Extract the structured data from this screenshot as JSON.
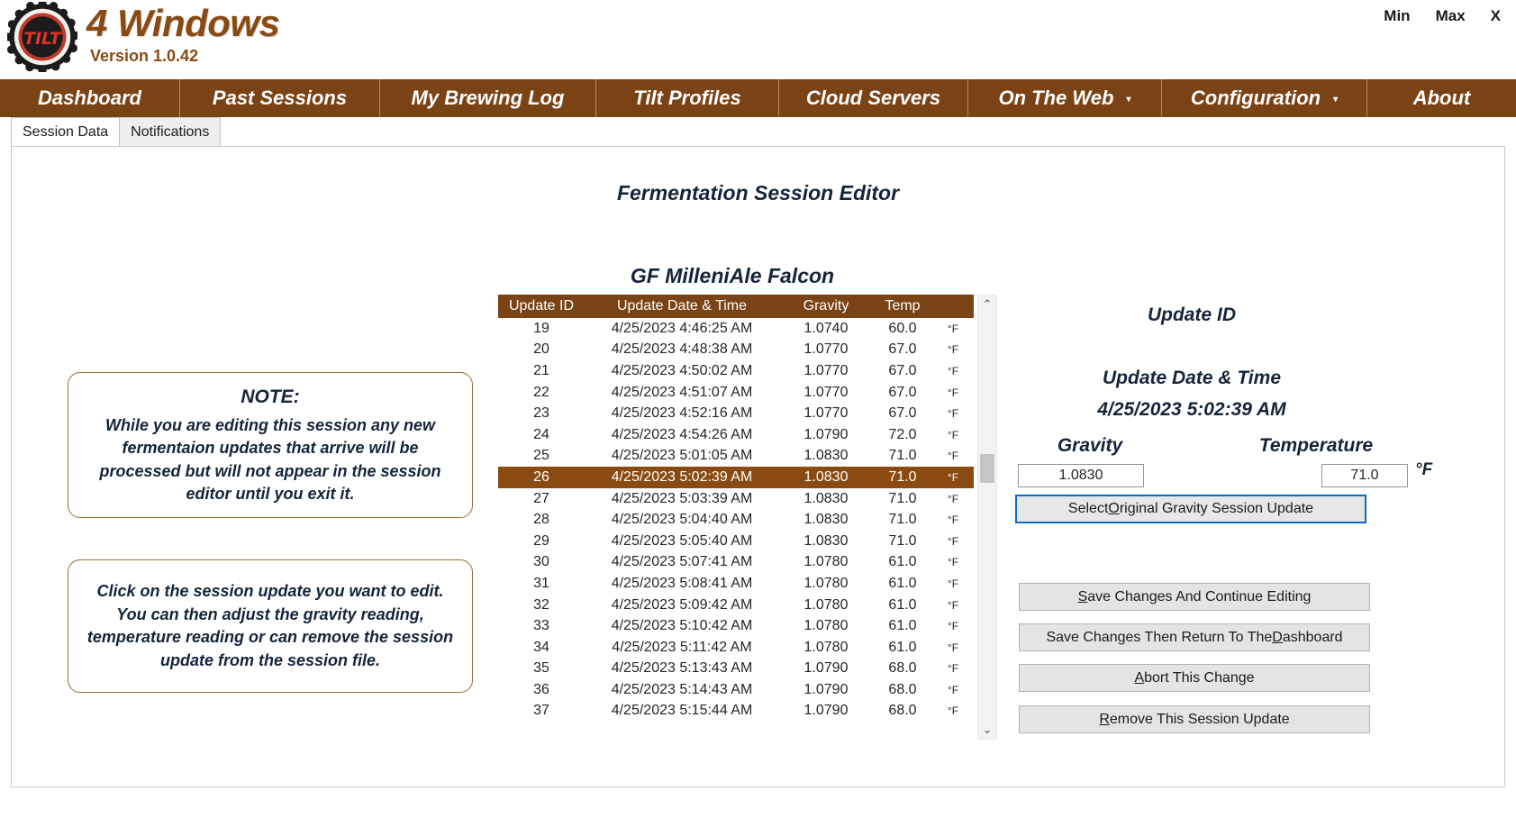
{
  "window": {
    "controls": [
      {
        "name": "minimize",
        "label": "Min"
      },
      {
        "name": "maximize",
        "label": "Max"
      },
      {
        "name": "close",
        "label": "X"
      }
    ]
  },
  "header": {
    "app_title": "4 Windows",
    "version": "Version 1.0.42",
    "logo_text": "TILT",
    "brand_color": "#8a4a12"
  },
  "menubar": {
    "accent_color": "#7a4316",
    "items": [
      {
        "label": "Dashboard",
        "has_caret": false
      },
      {
        "label": "Past Sessions",
        "has_caret": false
      },
      {
        "label": "My Brewing Log",
        "has_caret": false
      },
      {
        "label": "Tilt Profiles",
        "has_caret": false
      },
      {
        "label": "Cloud Servers",
        "has_caret": false
      },
      {
        "label": "On The Web",
        "has_caret": true,
        "caret": "▾"
      },
      {
        "label": "Configuration",
        "has_caret": true,
        "caret": "▾"
      },
      {
        "label": "About",
        "has_caret": false
      }
    ]
  },
  "tabs": [
    {
      "label": "Session Data",
      "active": true
    },
    {
      "label": "Notifications",
      "active": false
    }
  ],
  "main": {
    "editor_title": "Fermentation Session Editor",
    "session_name": "GF MilleniAle Falcon"
  },
  "notes": {
    "note1_head": "NOTE:",
    "note1_body": "While you are editing this session any new fermentaion updates that arrive will be processed but will not appear in the session editor until you exit it.",
    "note2_body": "Click on the session update you want to edit. You can then adjust the gravity reading, temperature reading or can remove the session update from the session file."
  },
  "table": {
    "columns": [
      "Update ID",
      "Update Date & Time",
      "Gravity",
      "Temp",
      ""
    ],
    "selected_id": 26,
    "rows": [
      {
        "id": "19",
        "datetime": "4/25/2023 4:46:25 AM",
        "gravity": "1.0740",
        "temp": "60.0",
        "unit": "°F"
      },
      {
        "id": "20",
        "datetime": "4/25/2023 4:48:38 AM",
        "gravity": "1.0770",
        "temp": "67.0",
        "unit": "°F"
      },
      {
        "id": "21",
        "datetime": "4/25/2023 4:50:02 AM",
        "gravity": "1.0770",
        "temp": "67.0",
        "unit": "°F"
      },
      {
        "id": "22",
        "datetime": "4/25/2023 4:51:07 AM",
        "gravity": "1.0770",
        "temp": "67.0",
        "unit": "°F"
      },
      {
        "id": "23",
        "datetime": "4/25/2023 4:52:16 AM",
        "gravity": "1.0770",
        "temp": "67.0",
        "unit": "°F"
      },
      {
        "id": "24",
        "datetime": "4/25/2023 4:54:26 AM",
        "gravity": "1.0790",
        "temp": "72.0",
        "unit": "°F"
      },
      {
        "id": "25",
        "datetime": "4/25/2023 5:01:05 AM",
        "gravity": "1.0830",
        "temp": "71.0",
        "unit": "°F"
      },
      {
        "id": "26",
        "datetime": "4/25/2023 5:02:39 AM",
        "gravity": "1.0830",
        "temp": "71.0",
        "unit": "°F"
      },
      {
        "id": "27",
        "datetime": "4/25/2023 5:03:39 AM",
        "gravity": "1.0830",
        "temp": "71.0",
        "unit": "°F"
      },
      {
        "id": "28",
        "datetime": "4/25/2023 5:04:40 AM",
        "gravity": "1.0830",
        "temp": "71.0",
        "unit": "°F"
      },
      {
        "id": "29",
        "datetime": "4/25/2023 5:05:40 AM",
        "gravity": "1.0830",
        "temp": "71.0",
        "unit": "°F"
      },
      {
        "id": "30",
        "datetime": "4/25/2023 5:07:41 AM",
        "gravity": "1.0780",
        "temp": "61.0",
        "unit": "°F"
      },
      {
        "id": "31",
        "datetime": "4/25/2023 5:08:41 AM",
        "gravity": "1.0780",
        "temp": "61.0",
        "unit": "°F"
      },
      {
        "id": "32",
        "datetime": "4/25/2023 5:09:42 AM",
        "gravity": "1.0780",
        "temp": "61.0",
        "unit": "°F"
      },
      {
        "id": "33",
        "datetime": "4/25/2023 5:10:42 AM",
        "gravity": "1.0780",
        "temp": "61.0",
        "unit": "°F"
      },
      {
        "id": "34",
        "datetime": "4/25/2023 5:11:42 AM",
        "gravity": "1.0780",
        "temp": "61.0",
        "unit": "°F"
      },
      {
        "id": "35",
        "datetime": "4/25/2023 5:13:43 AM",
        "gravity": "1.0790",
        "temp": "68.0",
        "unit": "°F"
      },
      {
        "id": "36",
        "datetime": "4/25/2023 5:14:43 AM",
        "gravity": "1.0790",
        "temp": "68.0",
        "unit": "°F"
      },
      {
        "id": "37",
        "datetime": "4/25/2023 5:15:44 AM",
        "gravity": "1.0790",
        "temp": "68.0",
        "unit": "°F"
      }
    ]
  },
  "detail": {
    "update_id_label": "Update ID",
    "update_id_value": "",
    "update_dt_label": "Update Date & Time",
    "update_dt_value": "4/25/2023 5:02:39 AM",
    "gravity_label": "Gravity",
    "gravity_value": "1.0830",
    "temperature_label": "Temperature",
    "temperature_value": "71.0",
    "temperature_unit": "°F"
  },
  "buttons": {
    "select_og": {
      "prefix": "Select ",
      "accel": "O",
      "suffix": "riginal Gravity Session Update",
      "focused": true
    },
    "save_continue": {
      "prefix": "",
      "accel": "S",
      "suffix": "ave Changes And Continue Editing"
    },
    "save_return": {
      "prefix": "Save Changes Then Return To The ",
      "accel": "D",
      "suffix": "ashboard"
    },
    "abort": {
      "prefix": "",
      "accel": "A",
      "suffix": "bort This Change"
    },
    "remove": {
      "prefix": "",
      "accel": "R",
      "suffix": "emove This Session Update"
    }
  },
  "scrollbar": {
    "up_glyph": "⌃",
    "down_glyph": "⌄"
  }
}
